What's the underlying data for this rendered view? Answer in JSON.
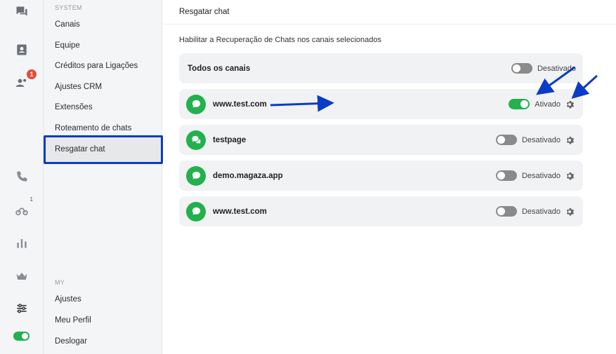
{
  "rail": {
    "badge_count": "1",
    "sup_count": "1"
  },
  "menu": {
    "system_label": "SYSTEM",
    "system_items": [
      {
        "label": "Canais"
      },
      {
        "label": "Equipe"
      },
      {
        "label": "Créditos para Ligações"
      },
      {
        "label": "Ajustes CRM"
      },
      {
        "label": "Extensões"
      },
      {
        "label": "Roteamento de chats"
      },
      {
        "label": "Resgatar chat",
        "active": true
      }
    ],
    "my_label": "MY",
    "my_items": [
      {
        "label": "Ajustes"
      },
      {
        "label": "Meu Perfil"
      },
      {
        "label": "Deslogar"
      }
    ]
  },
  "main": {
    "title": "Resgatar chat",
    "description": "Habilitar a Recuperação de Chats nos canais selecionados",
    "all_channels": {
      "label": "Todos os canais",
      "status": "Desativado",
      "enabled": false
    },
    "channels": [
      {
        "name": "www.test.com",
        "status": "Ativado",
        "enabled": true
      },
      {
        "name": "testpage",
        "status": "Desativado",
        "enabled": false
      },
      {
        "name": "demo.magaza.app",
        "status": "Desativado",
        "enabled": false
      },
      {
        "name": "www.test.com",
        "status": "Desativado",
        "enabled": false
      }
    ]
  },
  "colors": {
    "accent_green": "#22b14c",
    "highlight_blue": "#0a3cc7",
    "badge_red": "#e74c3c"
  }
}
